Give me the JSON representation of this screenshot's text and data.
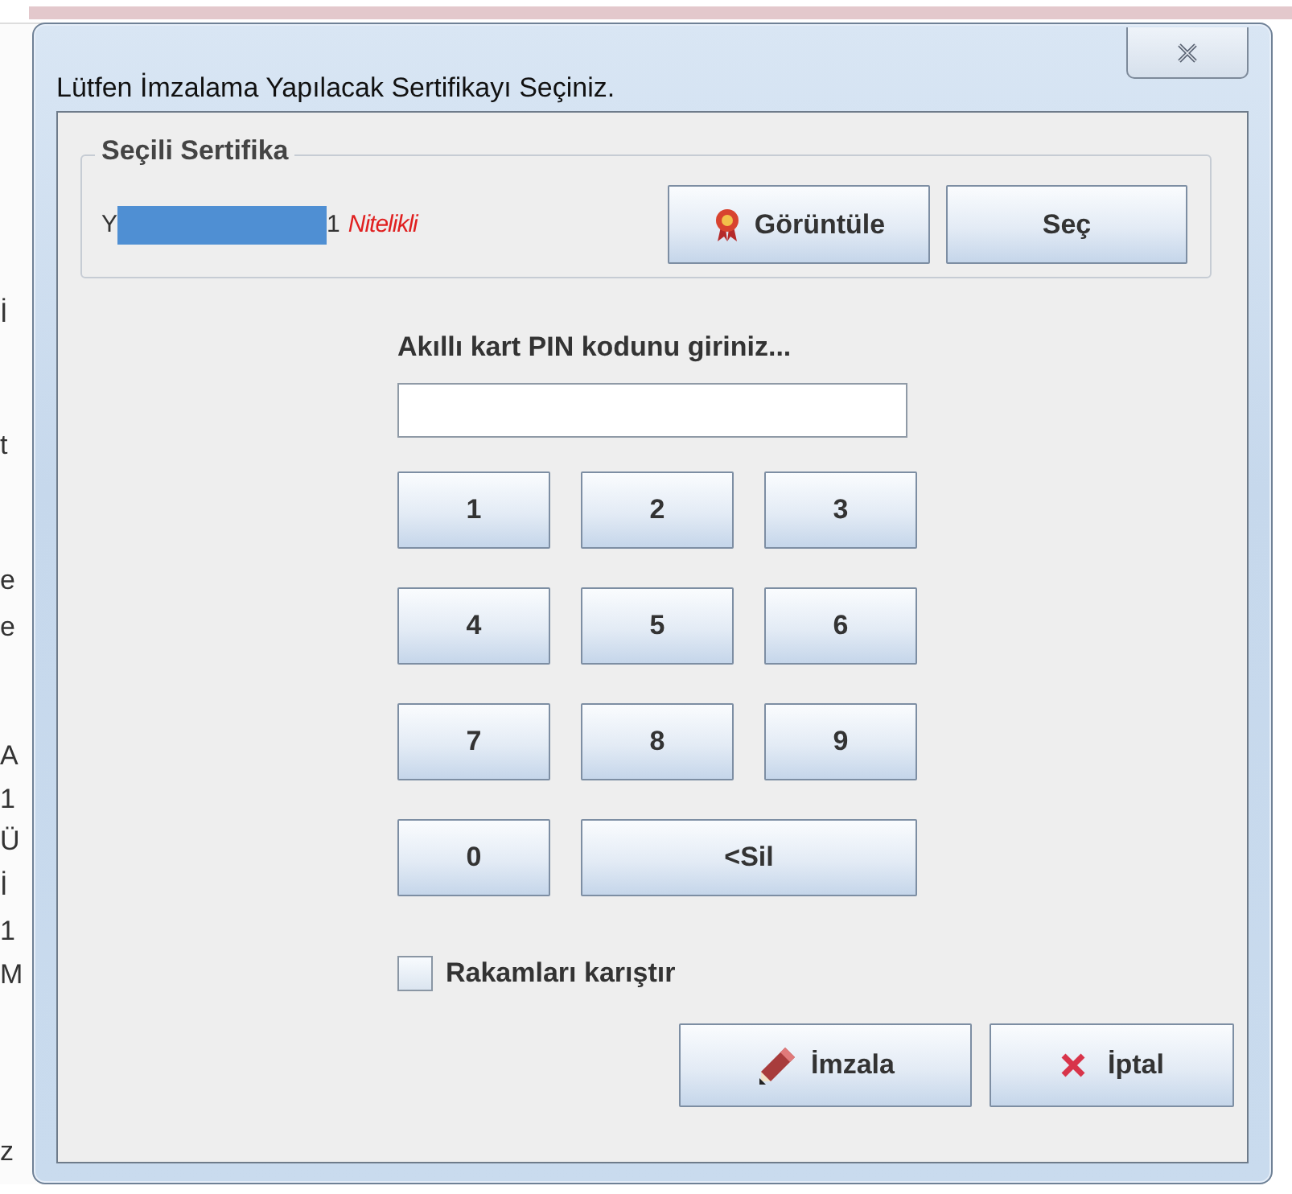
{
  "window": {
    "title": "Lütfen İmzalama Yapılacak Sertifikayı Seçiniz."
  },
  "background_fragments": [
    "İ",
    "t",
    "e",
    "e",
    "A",
    "1",
    "Ü",
    "İ",
    "1",
    "M",
    "z"
  ],
  "certificate": {
    "legend": "Seçili Sertifika",
    "name_start": "Y",
    "name_end": "1",
    "qualifier": "Nitelikli",
    "redacted": true,
    "buttons": [
      {
        "label": "Görüntüle",
        "kind": "view"
      },
      {
        "label": "Seç",
        "kind": "select"
      }
    ]
  },
  "pin": {
    "label": "Akıllı kart PIN kodunu giriniz..."
  },
  "keypad": [
    {
      "label": "1",
      "kind": "digit"
    },
    {
      "label": "2",
      "kind": "digit"
    },
    {
      "label": "3",
      "kind": "digit"
    },
    {
      "label": "4",
      "kind": "digit"
    },
    {
      "label": "5",
      "kind": "digit"
    },
    {
      "label": "6",
      "kind": "digit"
    },
    {
      "label": "7",
      "kind": "digit"
    },
    {
      "label": "8",
      "kind": "digit"
    },
    {
      "label": "9",
      "kind": "digit"
    },
    {
      "label": "0",
      "kind": "digit"
    },
    {
      "label": "<Sil",
      "kind": "delete"
    }
  ],
  "shuffle": {
    "label": "Rakamları karıştır",
    "checked": false
  },
  "actions": [
    {
      "label": "İmzala",
      "kind": "sign"
    },
    {
      "label": "İptal",
      "kind": "cancel"
    }
  ]
}
